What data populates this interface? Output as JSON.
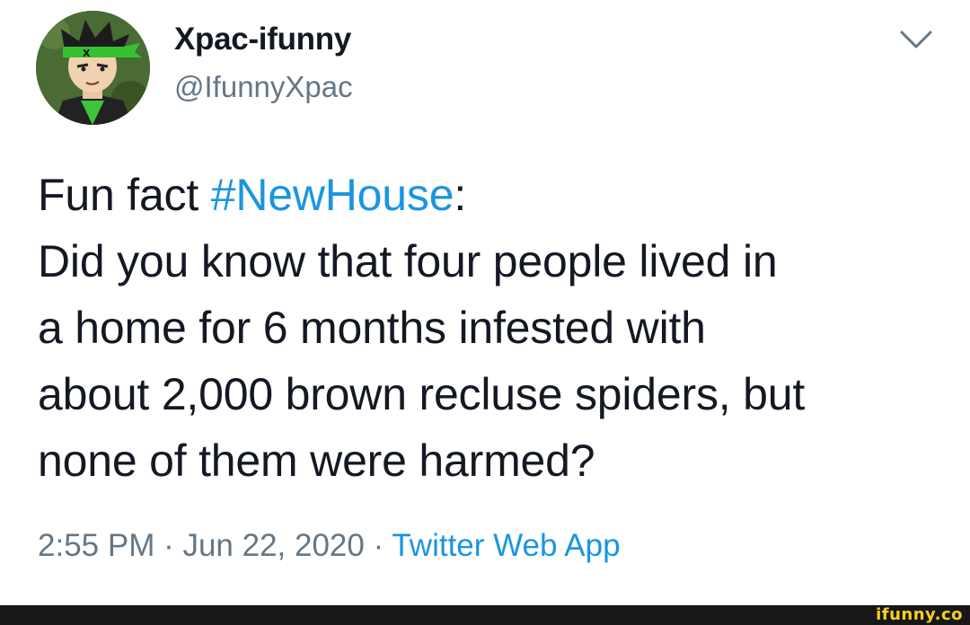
{
  "tweet": {
    "author": {
      "display_name": "Xpac-ifunny",
      "handle": "@IfunnyXpac",
      "avatar_icon": "cartoon-avatar-icon"
    },
    "text": {
      "line1_prefix": "Fun fact ",
      "hashtag": "#NewHouse",
      "line1_suffix": ":",
      "line2": "Did you know that four people lived in",
      "line3": "a home for 6 months infested with",
      "line4": "about 2,000 brown recluse spiders, but",
      "line5": "none of them were harmed?"
    },
    "meta": {
      "time": "2:55 PM",
      "separator1": " · ",
      "date": "Jun 22, 2020",
      "separator2": " · ",
      "source": "Twitter Web App"
    }
  },
  "footer": {
    "watermark": "ifunny.co"
  },
  "colors": {
    "text": "#141823",
    "secondary": "#657786",
    "link": "#1b95e0",
    "watermark": "#f7d11e",
    "footer_bg": "#171717"
  }
}
